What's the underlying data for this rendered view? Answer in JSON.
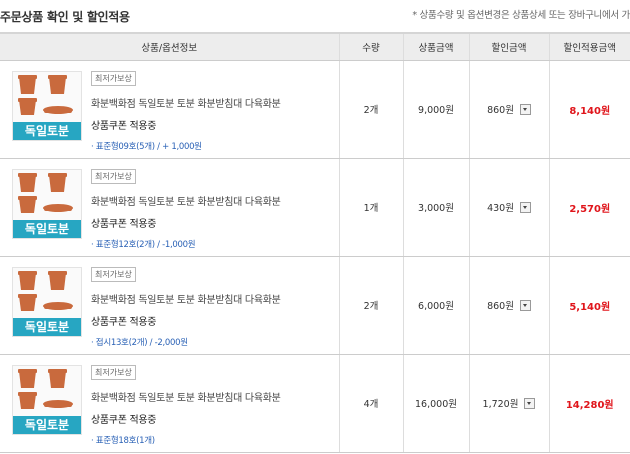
{
  "page": {
    "title": "주문상품 확인 및 할인적용",
    "notice": "* 상품수량 및 옵션변경은 상품상세 또는 장바구니에서 가"
  },
  "table": {
    "headers": [
      "상품/옵션정보",
      "수량",
      "상품금액",
      "할인금액",
      "할인적용금액"
    ]
  },
  "image_text": "독일토분",
  "rows": [
    {
      "badge": "최저가보상",
      "name": "화분백화점 독일토분 토분 화분받침대 다육화분",
      "coupon": "상품쿠폰 적용중",
      "option": "· 표준형09호(5개) / + 1,000원",
      "qty": "2개",
      "price": "9,000원",
      "discount": "860원",
      "final": "8,140원"
    },
    {
      "badge": "최저가보상",
      "name": "화분백화점 독일토분 토분 화분받침대 다육화분",
      "coupon": "상품쿠폰 적용중",
      "option": "· 표준형12호(2개) / -1,000원",
      "qty": "1개",
      "price": "3,000원",
      "discount": "430원",
      "final": "2,570원"
    },
    {
      "badge": "최저가보상",
      "name": "화분백화점 독일토분 토분 화분받침대 다육화분",
      "coupon": "상품쿠폰 적용중",
      "option": "· 접시13호(2개) / -2,000원",
      "qty": "2개",
      "price": "6,000원",
      "discount": "860원",
      "final": "5,140원"
    },
    {
      "badge": "최저가보상",
      "name": "화분백화점 독일토분 토분 화분받침대 다육화분",
      "coupon": "상품쿠폰 적용중",
      "option": "· 표준형18호(1개)",
      "qty": "4개",
      "price": "16,000원",
      "discount": "1,720원",
      "final": "14,280원"
    }
  ],
  "colors": {
    "final_amount": "#e0151b",
    "option_text": "#2b62b6",
    "image_banner": "#27a6c2",
    "pot": "#c96a3d"
  },
  "icons": {
    "dropdown": "chevron-down-icon"
  }
}
